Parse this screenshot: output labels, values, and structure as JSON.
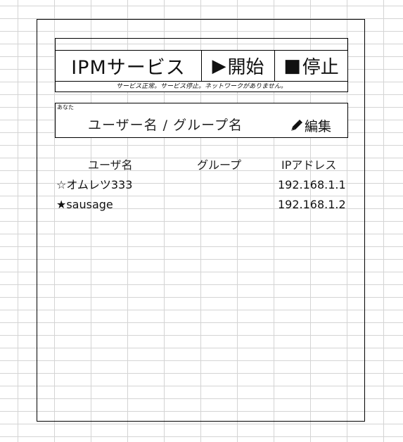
{
  "app": {
    "title": "IPMサービス",
    "start_glyph": "▶",
    "start_label": "開始",
    "stop_glyph": "■",
    "stop_label": "停止",
    "status": "サービス正常。サービス停止。ネットワークがありません。"
  },
  "you": {
    "label": "あなた",
    "name": "ユーザー名 / グループ名",
    "edit_label": "編集",
    "edit_icon": "pencil-icon"
  },
  "table": {
    "headers": [
      "ユーザ名",
      "グループ",
      "IPアドレス"
    ],
    "rows": [
      {
        "name": "☆オムレツ333",
        "group": "",
        "ip": "192.168.1.1"
      },
      {
        "name": "★sausage",
        "group": "",
        "ip": "192.168.1.2"
      }
    ]
  }
}
